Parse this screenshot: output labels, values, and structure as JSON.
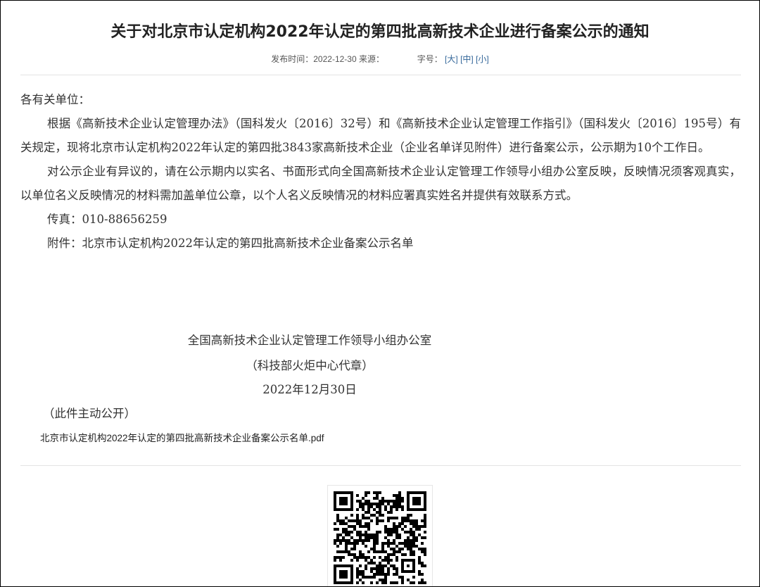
{
  "article": {
    "title": "关于对北京市认定机构2022年认定的第四批高新技术企业进行备案公示的通知",
    "meta": {
      "publish_label": "发布时间：",
      "publish_date": "2022-12-30",
      "source_label": "来源：",
      "source_value": "",
      "font_size_label": "字号：",
      "font_large": "[大]",
      "font_medium": "[中]",
      "font_small": "[小]"
    },
    "salutation": "各有关单位：",
    "paragraph_1": "根据《高新技术企业认定管理办法》（国科发火〔2016〕32号）和《高新技术企业认定管理工作指引》（国科发火〔2016〕195号）有关规定，现将北京市认定机构2022年认定的第四批3843家高新技术企业（企业名单详见附件）进行备案公示，公示期为10个工作日。",
    "paragraph_2": "对公示企业有异议的，请在公示期内以实名、书面形式向全国高新技术企业认定管理工作领导小组办公室反映，反映情况须客观真实，以单位名义反映情况的材料需加盖单位公章，以个人名义反映情况的材料应署真实姓名并提供有效联系方式。",
    "fax": "传真：010-88656259",
    "attachment_line": "附件：北京市认定机构2022年认定的第四批高新技术企业备案公示名单",
    "signature": {
      "org": "全国高新技术企业认定管理工作领导小组办公室",
      "seal": "（科技部火炬中心代章）",
      "date": "2022年12月30日"
    },
    "disclosure": "（此件主动公开）",
    "attachment_file": "北京市认定机构2022年认定的第四批高新技术企业备案公示名单.pdf"
  },
  "qr_code": {
    "icon": "qr-code"
  }
}
